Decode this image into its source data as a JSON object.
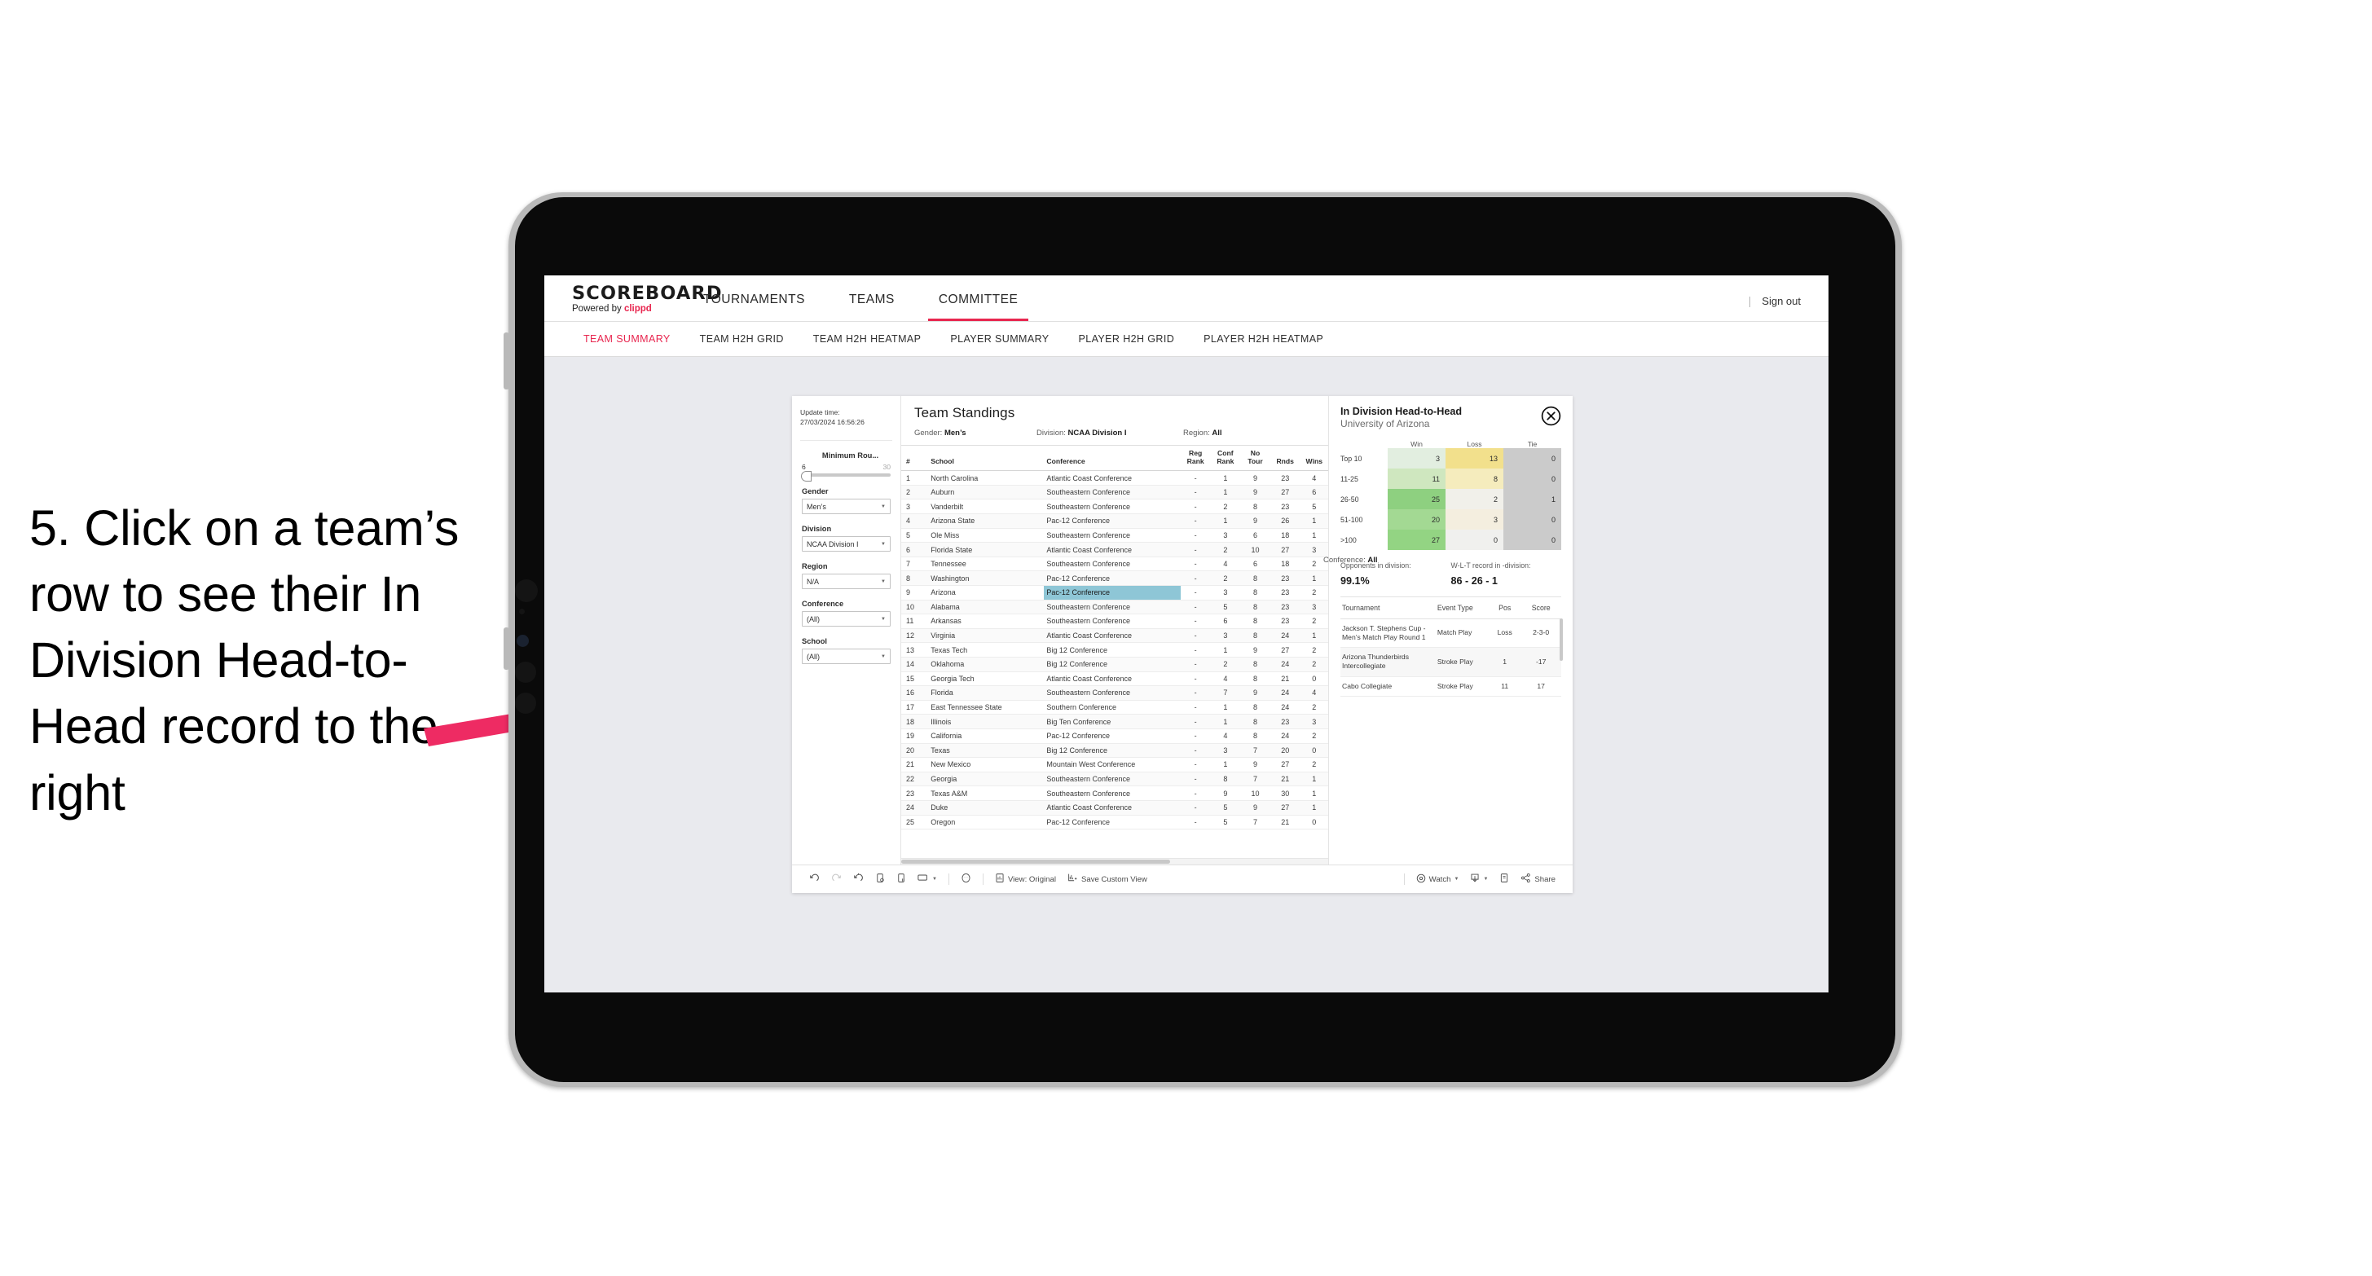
{
  "annotation": {
    "text": "5. Click on a team’s row to see their In Division Head-to-Head record to the right",
    "arrow_color": "#ee2b63"
  },
  "app": {
    "brand_title": "SCOREBOARD",
    "brand_powered_prefix": "Powered by ",
    "brand_powered_name": "clippd",
    "accent_color": "#e8264f",
    "top_nav": [
      {
        "label": "TOURNAMENTS",
        "active": false
      },
      {
        "label": "TEAMS",
        "active": false
      },
      {
        "label": "COMMITTEE",
        "active": true
      }
    ],
    "sign_out_separator": "|",
    "sign_out_label": "Sign out",
    "sub_nav": [
      {
        "label": "TEAM SUMMARY",
        "active": true
      },
      {
        "label": "TEAM H2H GRID",
        "active": false
      },
      {
        "label": "TEAM H2H HEATMAP",
        "active": false
      },
      {
        "label": "PLAYER SUMMARY",
        "active": false
      },
      {
        "label": "PLAYER H2H GRID",
        "active": false
      },
      {
        "label": "PLAYER H2H HEATMAP",
        "active": false
      }
    ]
  },
  "filters": {
    "update_time_label": "Update time:",
    "update_time_value": "27/03/2024 16:56:26",
    "slider": {
      "label": "Minimum Rou...",
      "min": "6",
      "max": "30"
    },
    "selects": [
      {
        "label": "Gender",
        "value": "Men’s"
      },
      {
        "label": "Division",
        "value": "NCAA Division I"
      },
      {
        "label": "Region",
        "value": "N/A"
      },
      {
        "label": "Conference",
        "value": "(All)"
      },
      {
        "label": "School",
        "value": "(All)"
      }
    ]
  },
  "standings": {
    "title": "Team Standings",
    "meta": [
      {
        "key": "Gender: ",
        "val": "Men’s"
      },
      {
        "key": "Division: ",
        "val": "NCAA Division I"
      },
      {
        "key": "Region: ",
        "val": "All"
      },
      {
        "key": "Conference: ",
        "val": "All"
      }
    ],
    "columns": [
      "#",
      "School",
      "Conference",
      "Reg Rank",
      "Conf Rank",
      "No Tour",
      "Rnds",
      "Wins"
    ],
    "highlight_row_index": 8,
    "rows": [
      {
        "num": "1",
        "school": "North Carolina",
        "conference": "Atlantic Coast Conference",
        "reg_rank": "-",
        "conf_rank": "1",
        "no_tour": "9",
        "rnds": "23",
        "wins": "4"
      },
      {
        "num": "2",
        "school": "Auburn",
        "conference": "Southeastern Conference",
        "reg_rank": "-",
        "conf_rank": "1",
        "no_tour": "9",
        "rnds": "27",
        "wins": "6"
      },
      {
        "num": "3",
        "school": "Vanderbilt",
        "conference": "Southeastern Conference",
        "reg_rank": "-",
        "conf_rank": "2",
        "no_tour": "8",
        "rnds": "23",
        "wins": "5"
      },
      {
        "num": "4",
        "school": "Arizona State",
        "conference": "Pac-12 Conference",
        "reg_rank": "-",
        "conf_rank": "1",
        "no_tour": "9",
        "rnds": "26",
        "wins": "1"
      },
      {
        "num": "5",
        "school": "Ole Miss",
        "conference": "Southeastern Conference",
        "reg_rank": "-",
        "conf_rank": "3",
        "no_tour": "6",
        "rnds": "18",
        "wins": "1"
      },
      {
        "num": "6",
        "school": "Florida State",
        "conference": "Atlantic Coast Conference",
        "reg_rank": "-",
        "conf_rank": "2",
        "no_tour": "10",
        "rnds": "27",
        "wins": "3"
      },
      {
        "num": "7",
        "school": "Tennessee",
        "conference": "Southeastern Conference",
        "reg_rank": "-",
        "conf_rank": "4",
        "no_tour": "6",
        "rnds": "18",
        "wins": "2"
      },
      {
        "num": "8",
        "school": "Washington",
        "conference": "Pac-12 Conference",
        "reg_rank": "-",
        "conf_rank": "2",
        "no_tour": "8",
        "rnds": "23",
        "wins": "1"
      },
      {
        "num": "9",
        "school": "Arizona",
        "conference": "Pac-12 Conference",
        "reg_rank": "-",
        "conf_rank": "3",
        "no_tour": "8",
        "rnds": "23",
        "wins": "2"
      },
      {
        "num": "10",
        "school": "Alabama",
        "conference": "Southeastern Conference",
        "reg_rank": "-",
        "conf_rank": "5",
        "no_tour": "8",
        "rnds": "23",
        "wins": "3"
      },
      {
        "num": "11",
        "school": "Arkansas",
        "conference": "Southeastern Conference",
        "reg_rank": "-",
        "conf_rank": "6",
        "no_tour": "8",
        "rnds": "23",
        "wins": "2"
      },
      {
        "num": "12",
        "school": "Virginia",
        "conference": "Atlantic Coast Conference",
        "reg_rank": "-",
        "conf_rank": "3",
        "no_tour": "8",
        "rnds": "24",
        "wins": "1"
      },
      {
        "num": "13",
        "school": "Texas Tech",
        "conference": "Big 12 Conference",
        "reg_rank": "-",
        "conf_rank": "1",
        "no_tour": "9",
        "rnds": "27",
        "wins": "2"
      },
      {
        "num": "14",
        "school": "Oklahoma",
        "conference": "Big 12 Conference",
        "reg_rank": "-",
        "conf_rank": "2",
        "no_tour": "8",
        "rnds": "24",
        "wins": "2"
      },
      {
        "num": "15",
        "school": "Georgia Tech",
        "conference": "Atlantic Coast Conference",
        "reg_rank": "-",
        "conf_rank": "4",
        "no_tour": "8",
        "rnds": "21",
        "wins": "0"
      },
      {
        "num": "16",
        "school": "Florida",
        "conference": "Southeastern Conference",
        "reg_rank": "-",
        "conf_rank": "7",
        "no_tour": "9",
        "rnds": "24",
        "wins": "4"
      },
      {
        "num": "17",
        "school": "East Tennessee State",
        "conference": "Southern Conference",
        "reg_rank": "-",
        "conf_rank": "1",
        "no_tour": "8",
        "rnds": "24",
        "wins": "2"
      },
      {
        "num": "18",
        "school": "Illinois",
        "conference": "Big Ten Conference",
        "reg_rank": "-",
        "conf_rank": "1",
        "no_tour": "8",
        "rnds": "23",
        "wins": "3"
      },
      {
        "num": "19",
        "school": "California",
        "conference": "Pac-12 Conference",
        "reg_rank": "-",
        "conf_rank": "4",
        "no_tour": "8",
        "rnds": "24",
        "wins": "2"
      },
      {
        "num": "20",
        "school": "Texas",
        "conference": "Big 12 Conference",
        "reg_rank": "-",
        "conf_rank": "3",
        "no_tour": "7",
        "rnds": "20",
        "wins": "0"
      },
      {
        "num": "21",
        "school": "New Mexico",
        "conference": "Mountain West Conference",
        "reg_rank": "-",
        "conf_rank": "1",
        "no_tour": "9",
        "rnds": "27",
        "wins": "2"
      },
      {
        "num": "22",
        "school": "Georgia",
        "conference": "Southeastern Conference",
        "reg_rank": "-",
        "conf_rank": "8",
        "no_tour": "7",
        "rnds": "21",
        "wins": "1"
      },
      {
        "num": "23",
        "school": "Texas A&M",
        "conference": "Southeastern Conference",
        "reg_rank": "-",
        "conf_rank": "9",
        "no_tour": "10",
        "rnds": "30",
        "wins": "1"
      },
      {
        "num": "24",
        "school": "Duke",
        "conference": "Atlantic Coast Conference",
        "reg_rank": "-",
        "conf_rank": "5",
        "no_tour": "9",
        "rnds": "27",
        "wins": "1"
      },
      {
        "num": "25",
        "school": "Oregon",
        "conference": "Pac-12 Conference",
        "reg_rank": "-",
        "conf_rank": "5",
        "no_tour": "7",
        "rnds": "21",
        "wins": "0"
      }
    ]
  },
  "h2h": {
    "title": "In Division Head-to-Head",
    "subtitle": "University of Arizona",
    "close_icon": "close-circle-icon",
    "opponents_label": "Opponents in division:",
    "opponents_value": "99.1%",
    "record_label": "W-L-T record in -division:",
    "record_value": "86 - 26 - 1",
    "tournament_columns": [
      "Tournament",
      "Event Type",
      "Pos",
      "Score"
    ],
    "tournaments": [
      {
        "name": "Jackson T. Stephens Cup - Men’s Match Play Round 1",
        "type": "Match Play",
        "pos": "Loss",
        "score": "2-3-0"
      },
      {
        "name": "Arizona Thunderbirds Intercollegiate",
        "type": "Stroke Play",
        "pos": "1",
        "score": "-17"
      },
      {
        "name": "Cabo Collegiate",
        "type": "Stroke Play",
        "pos": "11",
        "score": "17"
      }
    ],
    "chart_data": {
      "type": "heatmap",
      "title": "In Division Head-to-Head",
      "subtitle": "University of Arizona",
      "xlabel": "",
      "ylabel": "",
      "columns": [
        "Win",
        "Loss",
        "Tie"
      ],
      "rows": [
        "Top 10",
        "11-25",
        "26-50",
        "51-100",
        ">100"
      ],
      "values": [
        [
          3,
          13,
          0
        ],
        [
          11,
          8,
          0
        ],
        [
          25,
          2,
          1
        ],
        [
          20,
          3,
          0
        ],
        [
          27,
          0,
          0
        ]
      ],
      "cell_colors": [
        [
          "#e2eee0",
          "#f2e08c",
          "#cbcbcb"
        ],
        [
          "#cfe7bf",
          "#f5ecbd",
          "#cbcbcb"
        ],
        [
          "#8ed080",
          "#f1f0ea",
          "#cbcbcb"
        ],
        [
          "#a3d993",
          "#f4eedf",
          "#cbcbcb"
        ],
        [
          "#93d483",
          "#f0f0ee",
          "#cbcbcb"
        ]
      ],
      "legend_position": "none",
      "grid": false
    }
  },
  "toolbar": {
    "items": [
      {
        "icon": "undo-icon",
        "label": "",
        "dropdown": false
      },
      {
        "icon": "redo-icon",
        "label": "",
        "dropdown": false
      },
      {
        "icon": "revert-icon",
        "label": "",
        "dropdown": false
      },
      {
        "icon": "refresh-data-icon",
        "label": "",
        "dropdown": false
      },
      {
        "icon": "pause-updates-icon",
        "label": "",
        "dropdown": false
      },
      {
        "icon": "device-layout-icon",
        "label": "",
        "dropdown": true
      },
      {
        "icon": "history-icon",
        "label": "",
        "dropdown": false
      },
      {
        "icon": "view-original-icon",
        "label": "View: Original",
        "dropdown": false
      },
      {
        "icon": "save-view-icon",
        "label": "Save Custom View",
        "dropdown": false
      },
      {
        "icon": "watch-icon",
        "label": "Watch",
        "dropdown": true
      },
      {
        "icon": "download-icon",
        "label": "",
        "dropdown": true
      },
      {
        "icon": "fullscreen-icon",
        "label": "",
        "dropdown": false
      },
      {
        "icon": "share-icon",
        "label": "Share",
        "dropdown": false
      }
    ]
  }
}
